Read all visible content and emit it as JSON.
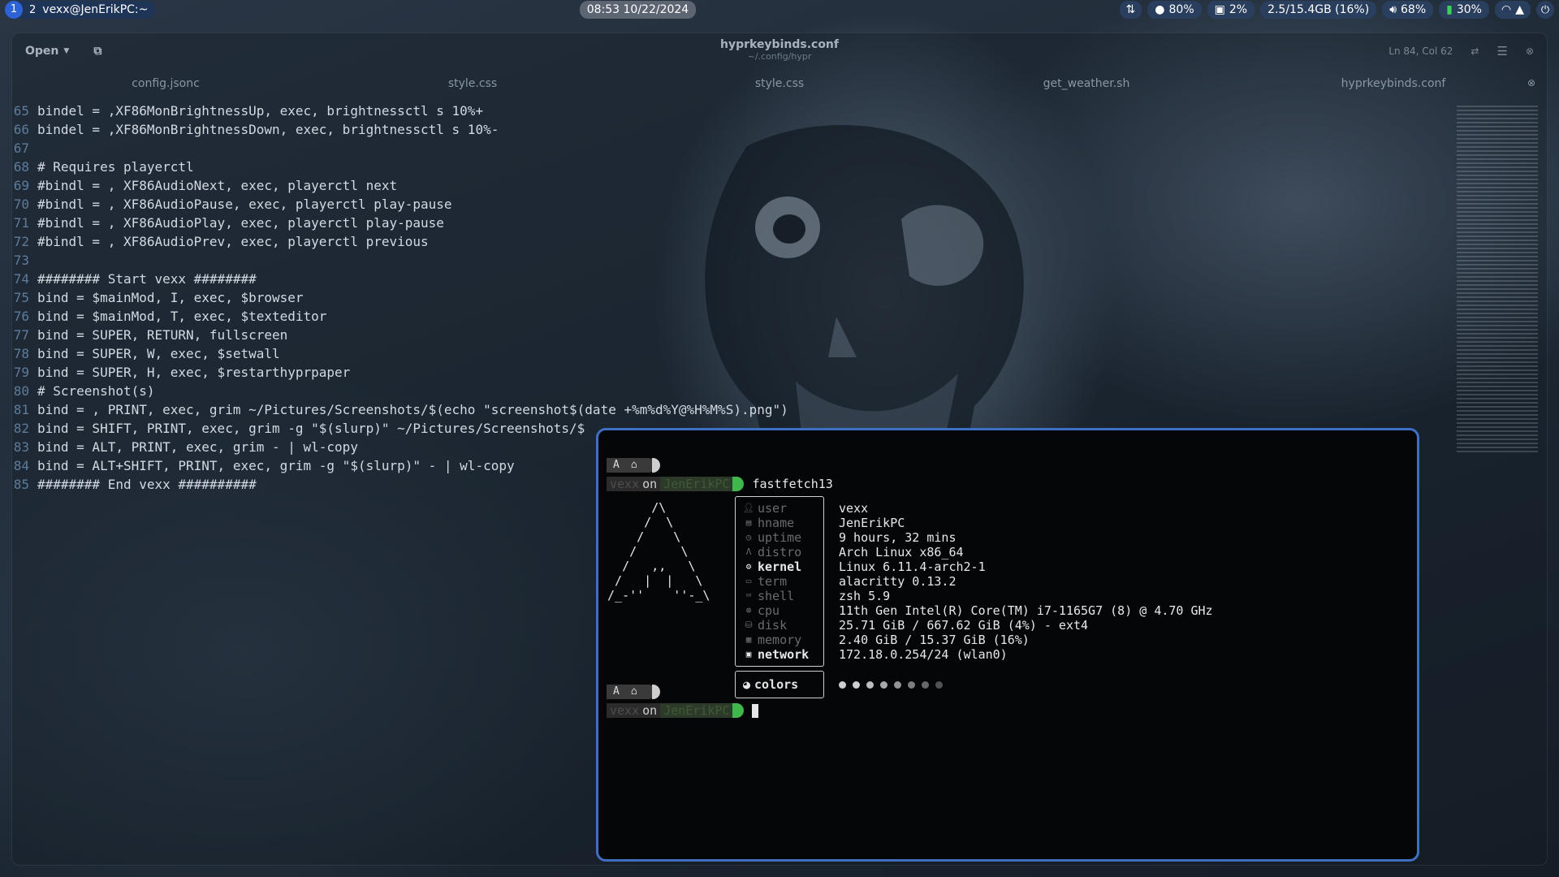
{
  "topbar": {
    "workspace_active": "1",
    "workspace_other": "2",
    "window_title": "vexx@JenErikPC:~",
    "clock": "08:53  10/22/2024",
    "cpu_temp": "80%",
    "cpu": "2%",
    "memory": "2.5/15.4GB (16%)",
    "volume": "68%",
    "battery": "30%"
  },
  "editor": {
    "open_label": "Open",
    "title": "hyprkeybinds.conf",
    "subtitle": "~/.config/hypr",
    "position": "Ln 84, Col 62",
    "tabs": [
      "config.jsonc",
      "style.css",
      "style.css",
      "get_weather.sh",
      "hyprkeybinds.conf"
    ],
    "lines": [
      {
        "n": "65",
        "t": "bindel = ,XF86MonBrightnessUp, exec, brightnessctl s 10%+"
      },
      {
        "n": "66",
        "t": "bindel = ,XF86MonBrightnessDown, exec, brightnessctl s 10%-"
      },
      {
        "n": "67",
        "t": ""
      },
      {
        "n": "68",
        "t": "# Requires playerctl"
      },
      {
        "n": "69",
        "t": "#bindl = , XF86AudioNext, exec, playerctl next"
      },
      {
        "n": "70",
        "t": "#bindl = , XF86AudioPause, exec, playerctl play-pause"
      },
      {
        "n": "71",
        "t": "#bindl = , XF86AudioPlay, exec, playerctl play-pause"
      },
      {
        "n": "72",
        "t": "#bindl = , XF86AudioPrev, exec, playerctl previous"
      },
      {
        "n": "73",
        "t": ""
      },
      {
        "n": "74",
        "t": "######## Start vexx ########"
      },
      {
        "n": "75",
        "t": "bind = $mainMod, I, exec, $browser"
      },
      {
        "n": "76",
        "t": "bind = $mainMod, T, exec, $texteditor"
      },
      {
        "n": "77",
        "t": "bind = SUPER, RETURN, fullscreen"
      },
      {
        "n": "78",
        "t": "bind = SUPER, W, exec, $setwall"
      },
      {
        "n": "79",
        "t": "bind = SUPER, H, exec, $restarthyprpaper"
      },
      {
        "n": "80",
        "t": "# Screenshot(s)"
      },
      {
        "n": "81",
        "t": "bind = , PRINT, exec, grim ~/Pictures/Screenshots/$(echo \"screenshot$(date +%m%d%Y@%H%M%S).png\")"
      },
      {
        "n": "82",
        "t": "bind = SHIFT, PRINT, exec, grim -g \"$(slurp)\" ~/Pictures/Screenshots/$"
      },
      {
        "n": "83",
        "t": "bind = ALT, PRINT, exec, grim - | wl-copy"
      },
      {
        "n": "84",
        "t": "bind = ALT+SHIFT, PRINT, exec, grim -g \"$(slurp)\" - | wl-copy"
      },
      {
        "n": "85",
        "t": "######## End vexx ##########"
      }
    ]
  },
  "terminal": {
    "prompt_a": "A",
    "prompt_home": "⌂",
    "user": "vexx",
    "on": "on",
    "host": "JenErikPC",
    "command": "fastfetch13",
    "ascii": "       /\\\n      /  \\\n     /    \\\n    /      \\\n   /   ,,   \\\n  /   |  |   \\\n /_-''    ''-_\\",
    "info": [
      {
        "key": "user",
        "val": "vexx",
        "bright": false,
        "icon": "user-icon"
      },
      {
        "key": "hname",
        "val": "JenErikPC",
        "bright": false,
        "icon": "host-icon"
      },
      {
        "key": "uptime",
        "val": "9 hours, 32 mins",
        "bright": false,
        "icon": "clock-icon"
      },
      {
        "key": "distro",
        "val": "Arch Linux x86_64",
        "bright": false,
        "icon": "arch-icon"
      },
      {
        "key": "kernel",
        "val": "Linux 6.11.4-arch2-1",
        "bright": true,
        "icon": "gear-icon"
      },
      {
        "key": "term",
        "val": "alacritty 0.13.2",
        "bright": false,
        "icon": "terminal-icon"
      },
      {
        "key": "shell",
        "val": "zsh 5.9",
        "bright": false,
        "icon": "shell-icon"
      },
      {
        "key": "cpu",
        "val": "11th Gen Intel(R) Core(TM) i7-1165G7 (8) @ 4.70 GHz",
        "bright": false,
        "icon": "cpu-icon"
      },
      {
        "key": "disk",
        "val": "25.71 GiB / 667.62 GiB (4%) - ext4",
        "bright": false,
        "icon": "disk-icon"
      },
      {
        "key": "memory",
        "val": "2.40 GiB / 15.37 GiB (16%)",
        "bright": false,
        "icon": "memory-icon"
      },
      {
        "key": "network",
        "val": "172.18.0.254/24 (wlan0)",
        "bright": true,
        "icon": "network-icon"
      }
    ],
    "colors_label": "colors",
    "color_dots": [
      "#cfcfcf",
      "#cfcfcf",
      "#bdbdbd",
      "#a8a8a8",
      "#939393",
      "#7d7d7d",
      "#676767",
      "#525252"
    ]
  }
}
